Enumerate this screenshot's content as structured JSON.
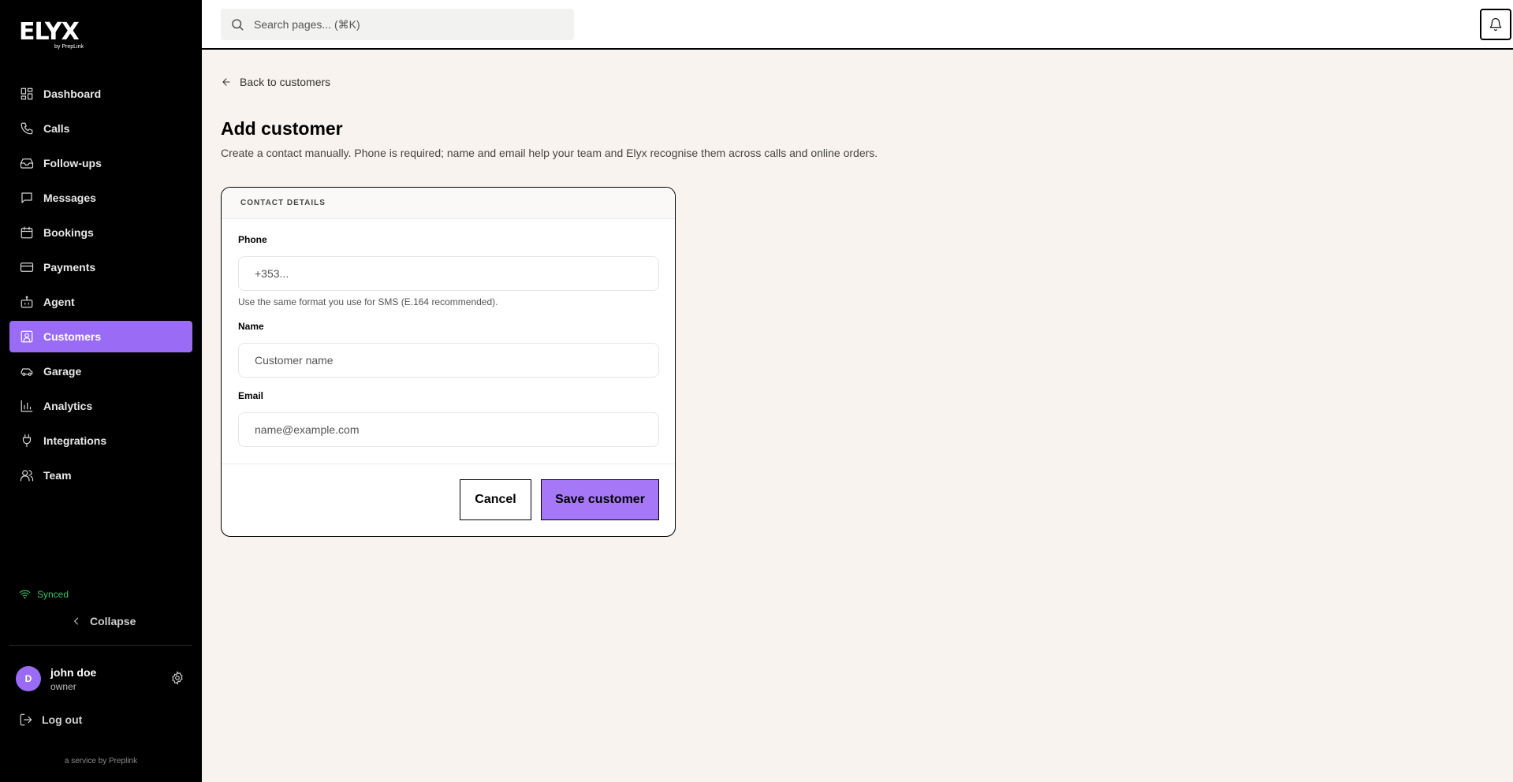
{
  "brand": {
    "name": "ELYX",
    "sub": "by PrepLink"
  },
  "sidebar": {
    "items": [
      {
        "label": "Dashboard",
        "icon": "dashboard-icon"
      },
      {
        "label": "Calls",
        "icon": "phone-icon"
      },
      {
        "label": "Follow-ups",
        "icon": "inbox-icon"
      },
      {
        "label": "Messages",
        "icon": "message-icon"
      },
      {
        "label": "Bookings",
        "icon": "calendar-icon"
      },
      {
        "label": "Payments",
        "icon": "credit-card-icon"
      },
      {
        "label": "Agent",
        "icon": "bot-icon"
      },
      {
        "label": "Customers",
        "icon": "contact-icon",
        "active": true
      },
      {
        "label": "Garage",
        "icon": "car-icon"
      },
      {
        "label": "Analytics",
        "icon": "chart-icon"
      },
      {
        "label": "Integrations",
        "icon": "plug-icon"
      },
      {
        "label": "Team",
        "icon": "users-icon"
      }
    ],
    "status": "Synced",
    "collapse_label": "Collapse",
    "user": {
      "initial": "D",
      "name": "john doe",
      "role": "owner"
    },
    "logout_label": "Log out",
    "service_text": "a service by Preplink"
  },
  "topbar": {
    "search_placeholder": "Search pages... (⌘K)"
  },
  "main": {
    "back_label": "Back to customers",
    "title": "Add customer",
    "description": "Create a contact manually. Phone is required; name and email help your team and Elyx recognise them across calls and online orders.",
    "card": {
      "header": "CONTACT DETAILS",
      "phone": {
        "label": "Phone",
        "placeholder": "+353...",
        "value": "",
        "hint": "Use the same format you use for SMS (E.164 recommended)."
      },
      "name": {
        "label": "Name",
        "placeholder": "Customer name",
        "value": ""
      },
      "email": {
        "label": "Email",
        "placeholder": "name@example.com",
        "value": ""
      },
      "cancel_label": "Cancel",
      "save_label": "Save customer"
    }
  },
  "colors": {
    "accent": "#9a6cf6",
    "save_button": "#a678f7",
    "synced": "#3ac26a",
    "sidebar_bg": "#000000",
    "page_bg": "#f8f3ee"
  }
}
